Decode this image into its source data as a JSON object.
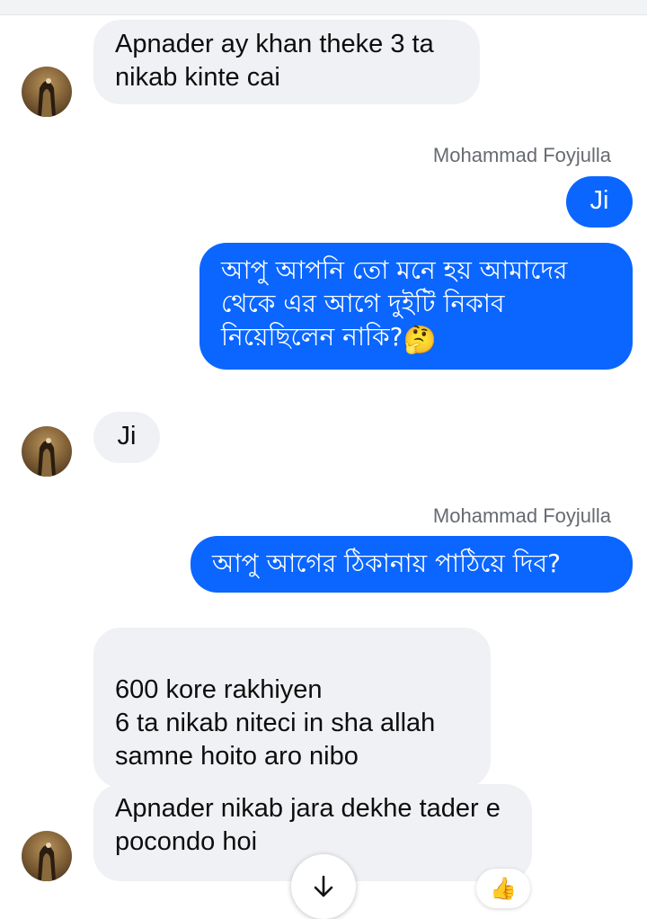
{
  "messages": [
    {
      "side": "in",
      "text": "Apnader ay khan theke 3 ta nikab kinte cai"
    },
    {
      "side": "out",
      "sender": "Mohammad Foyjulla",
      "text": "Ji"
    },
    {
      "side": "out",
      "text": "আপু আপনি তো মনে হয় আমাদের থেকে এর আগে দুইটি নিকাব নিয়েছিলেন নাকি?",
      "emoji": "🤔"
    },
    {
      "side": "in",
      "text": "Ji"
    },
    {
      "side": "out",
      "sender": "Mohammad Foyjulla",
      "text": "আপু আগের ঠিকানায় পাঠিয়ে দিব?"
    },
    {
      "side": "in",
      "text": "600 kore rakhiyen\n6 ta nikab niteci in sha allah\nsamne hoito aro nibo"
    },
    {
      "side": "in",
      "text": "Apnader nikab jara dekhe tader e pocondo hoi",
      "reaction": "👍"
    }
  ],
  "colors": {
    "outgoing_bubble": "#0a66ff",
    "incoming_bubble": "#f0f1f4",
    "sender_text": "#666a70"
  },
  "icons": {
    "scroll_down": "arrow-down-icon",
    "reaction": "thumbs-up-emoji",
    "avatar": "contact-avatar"
  }
}
